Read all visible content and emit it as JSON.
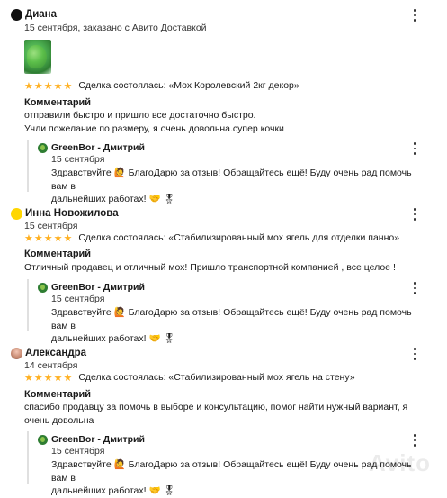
{
  "colors": {
    "star": "#ffb021",
    "reply_bar": "#e0e0e0"
  },
  "reviews": [
    {
      "author": "Диана",
      "date": "15 сентября, заказано с Авито Доставкой",
      "stars": "★★★★★",
      "deal": "Сделка состоялась: «Мох Королевский 2кг декор»",
      "comment_title": "Комментарий",
      "comment_lines": [
        "отправили быстро и пришло все достаточно быстро.",
        "Учли пожелание по размеру, я очень довольна.супер кочки"
      ],
      "reply": {
        "seller": "GreenBor - Дмитрий",
        "date": "15 сентября",
        "lines": [
          "Здравствуйте 🙋 БлагоДарю за отзыв! Обращайтесь ещё! Буду очень рад помочь вам в",
          "дальнейших работах! 🤝 🎖"
        ]
      }
    },
    {
      "author": "Инна Новожилова",
      "date": "15 сентября",
      "stars": "★★★★★",
      "deal": "Сделка состоялась: «Стабилизированный мох ягель для отделки панно»",
      "comment_title": "Комментарий",
      "comment_lines": [
        "Отличный продавец и отличный мох! Пришло транспортной компанией , все целое !"
      ],
      "reply": {
        "seller": "GreenBor - Дмитрий",
        "date": "15 сентября",
        "lines": [
          "Здравствуйте 🙋 БлагоДарю за отзыв! Обращайтесь ещё! Буду очень рад помочь вам в",
          "дальнейших работах! 🤝 🎖"
        ]
      }
    },
    {
      "author": "Александра",
      "date": "14 сентября",
      "stars": "★★★★★",
      "deal": "Сделка состоялась: «Стабилизированный мох ягель на стену»",
      "comment_title": "Комментарий",
      "comment_lines": [
        "спасибо продавцу за помочь в выборе и консультацию, помог найти нужный вариант, я",
        "очень довольна"
      ],
      "reply": {
        "seller": "GreenBor - Дмитрий",
        "date": "15 сентября",
        "lines": [
          "Здравствуйте 🙋 БлагоДарю за отзыв! Обращайтесь ещё! Буду очень рад помочь вам в",
          "дальнейших работах! 🤝 🎖"
        ]
      }
    }
  ],
  "watermark": "Avito"
}
